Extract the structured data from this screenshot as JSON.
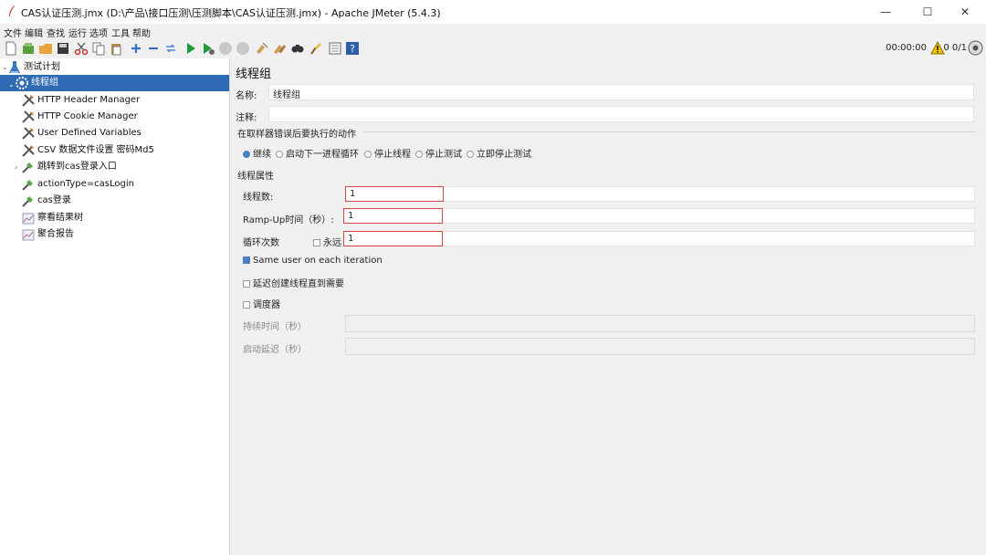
{
  "window": {
    "title": "CAS认证压测.jmx (D:\\产品\\接口压测\\压测脚本\\CAS认证压测.jmx) - Apache JMeter (5.4.3)",
    "minimize": "—",
    "maximize": "☐",
    "close": "✕"
  },
  "menu": [
    "文件",
    "编辑",
    "查找",
    "运行",
    "选项",
    "工具",
    "帮助"
  ],
  "toolbar": {
    "icons": [
      "new-icon",
      "templates-icon",
      "open-icon",
      "save-icon",
      "cut-icon",
      "copy-icon",
      "paste-icon",
      "expand-icon",
      "collapse-icon",
      "toggle-icon",
      "start-icon",
      "start-no-pause-icon",
      "stop-icon",
      "shutdown-icon",
      "clear-icon",
      "clear-all-icon",
      "search-icon",
      "reset-search-icon",
      "function-helper-icon",
      "help-icon"
    ],
    "timer": "00:00:00",
    "threads": "0 0/1"
  },
  "tree": [
    {
      "label": "测试计划",
      "icon": "test-plan-icon",
      "selected": false
    },
    {
      "label": "线程组",
      "icon": "thread-group-icon",
      "selected": true
    },
    {
      "label": "HTTP Header Manager",
      "icon": "config-element-icon"
    },
    {
      "label": "HTTP Cookie Manager",
      "icon": "config-element-icon"
    },
    {
      "label": "User Defined Variables",
      "icon": "config-element-icon"
    },
    {
      "label": "CSV 数据文件设置 密码Md5",
      "icon": "config-element-icon"
    },
    {
      "label": "跳转到cas登录入口",
      "icon": "sampler-icon"
    },
    {
      "label": "actionType=casLogin",
      "icon": "sampler-icon"
    },
    {
      "label": "cas登录",
      "icon": "sampler-icon"
    },
    {
      "label": "察看结果树",
      "icon": "listener-icon"
    },
    {
      "label": "聚合报告",
      "icon": "listener-icon"
    }
  ],
  "panel": {
    "title": "线程组",
    "name_label": "名称:",
    "name_value": "线程组",
    "comment_label": "注释:",
    "comment_value": "",
    "error_section": "在取样器错误后要执行的动作",
    "error_options": [
      "继续",
      "启动下一进程循环",
      "停止线程",
      "停止测试",
      "立即停止测试"
    ],
    "error_selected": "继续",
    "props_section": "线程属性",
    "threads_label": "线程数:",
    "threads_value": "1",
    "rampup_label": "Ramp-Up时间（秒）:",
    "rampup_value": "1",
    "loop_label": "循环次数",
    "forever_label": "永远",
    "loop_value": "1",
    "same_user_label": "Same user on each iteration",
    "same_user_checked": true,
    "delay_label": "延迟创建线程直到需要",
    "delay_checked": false,
    "scheduler_label": "调度器",
    "scheduler_checked": false,
    "duration_label": "持续时间（秒）",
    "startup_delay_label": "启动延迟（秒）"
  },
  "colors": {
    "selection": "#2f6ab4",
    "highlight_border": "#dd4444",
    "radio_accent": "#4a7fc1"
  }
}
